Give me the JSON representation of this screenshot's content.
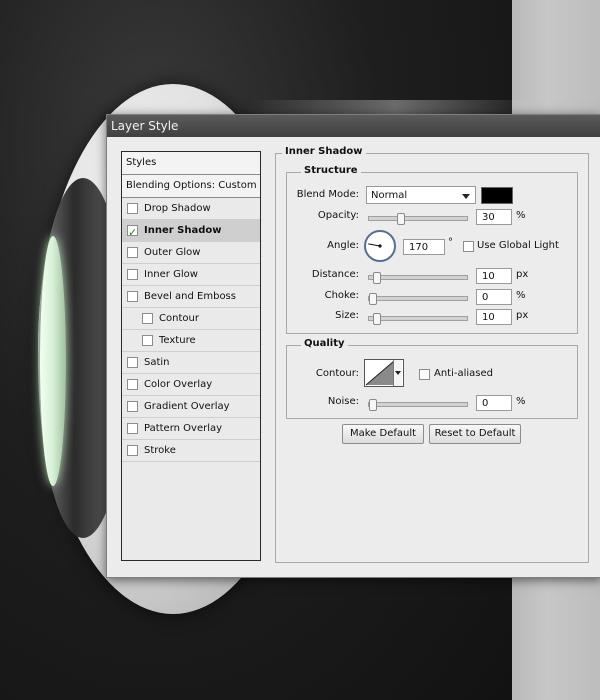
{
  "window": {
    "title": "Layer Style"
  },
  "styles_list": {
    "header": "Styles",
    "blending": "Blending Options: Custom",
    "items": [
      {
        "label": "Drop Shadow",
        "checked": false,
        "active": false,
        "sub": false
      },
      {
        "label": "Inner Shadow",
        "checked": true,
        "active": true,
        "sub": false
      },
      {
        "label": "Outer Glow",
        "checked": false,
        "active": false,
        "sub": false
      },
      {
        "label": "Inner Glow",
        "checked": false,
        "active": false,
        "sub": false
      },
      {
        "label": "Bevel and Emboss",
        "checked": false,
        "active": false,
        "sub": false
      },
      {
        "label": "Contour",
        "checked": false,
        "active": false,
        "sub": true
      },
      {
        "label": "Texture",
        "checked": false,
        "active": false,
        "sub": true
      },
      {
        "label": "Satin",
        "checked": false,
        "active": false,
        "sub": false
      },
      {
        "label": "Color Overlay",
        "checked": false,
        "active": false,
        "sub": false
      },
      {
        "label": "Gradient Overlay",
        "checked": false,
        "active": false,
        "sub": false
      },
      {
        "label": "Pattern Overlay",
        "checked": false,
        "active": false,
        "sub": false
      },
      {
        "label": "Stroke",
        "checked": false,
        "active": false,
        "sub": false
      }
    ]
  },
  "inner_shadow": {
    "title": "Inner Shadow",
    "structure": {
      "title": "Structure",
      "blend_mode_label": "Blend Mode:",
      "blend_mode_value": "Normal",
      "shadow_color": "#000000",
      "opacity_label": "Opacity:",
      "opacity_value": "30",
      "opacity_unit": "%",
      "opacity_level": 0.3,
      "angle_label": "Angle:",
      "angle_value": "170",
      "angle_unit": "°",
      "angle_degrees": 170,
      "use_global_light_label": "Use Global Light",
      "use_global_light_checked": false,
      "distance_label": "Distance:",
      "distance_value": "10",
      "distance_unit": "px",
      "distance_level": 0.04,
      "choke_label": "Choke:",
      "choke_value": "0",
      "choke_unit": "%",
      "choke_level": 0,
      "size_label": "Size:",
      "size_value": "10",
      "size_unit": "px",
      "size_level": 0.04
    },
    "quality": {
      "title": "Quality",
      "contour_label": "Contour:",
      "anti_aliased_label": "Anti-aliased",
      "anti_aliased_checked": false,
      "noise_label": "Noise:",
      "noise_value": "0",
      "noise_unit": "%",
      "noise_level": 0
    },
    "buttons": {
      "make_default": "Make Default",
      "reset_to_default": "Reset to Default"
    }
  }
}
